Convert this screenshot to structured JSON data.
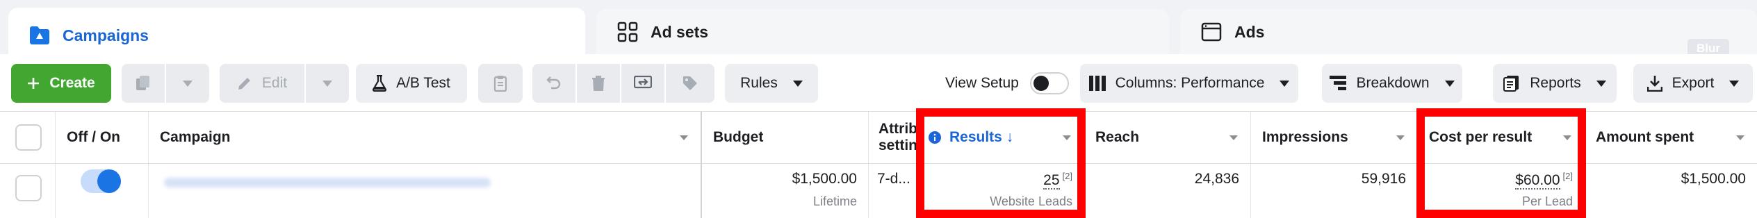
{
  "tabs": {
    "campaigns": "Campaigns",
    "adsets": "Ad sets",
    "ads": "Ads",
    "blur_badge": "Blur"
  },
  "toolbar": {
    "create": "Create",
    "edit": "Edit",
    "ab_test": "A/B Test",
    "rules": "Rules",
    "view_setup": "View Setup",
    "columns": "Columns: Performance",
    "breakdown": "Breakdown",
    "reports": "Reports",
    "export": "Export"
  },
  "table": {
    "headers": {
      "off_on": "Off / On",
      "campaign": "Campaign",
      "budget": "Budget",
      "attribution_line1": "Attrib",
      "attribution_line2": "settin",
      "results": "Results ↓",
      "reach": "Reach",
      "impressions": "Impressions",
      "cost_per_result": "Cost per result",
      "amount_spent": "Amount spent"
    },
    "row": {
      "budget": "$1,500.00",
      "budget_sub": "Lifetime",
      "attribution": "7-d...",
      "results": "25",
      "results_sup": "[2]",
      "results_sub": "Website Leads",
      "reach": "24,836",
      "impressions": "59,916",
      "cost_per_result": "$60.00",
      "cost_sup": "[2]",
      "cost_sub": "Per Lead",
      "amount_spent": "$1,500.00"
    }
  },
  "colors": {
    "accent": "#1b66d6",
    "create_green": "#42a730",
    "highlight": "#ff0000"
  },
  "icons": [
    "campaigns-folder-icon",
    "adsets-grid-icon",
    "ads-window-icon",
    "plus-icon",
    "duplicate-icon",
    "pencil-icon",
    "flask-icon",
    "clipboard-icon",
    "undo-icon",
    "trash-icon",
    "swap-icon",
    "tag-icon",
    "columns-icon",
    "breakdown-icon",
    "reports-icon",
    "download-icon",
    "info-icon",
    "chevron-down-icon"
  ]
}
